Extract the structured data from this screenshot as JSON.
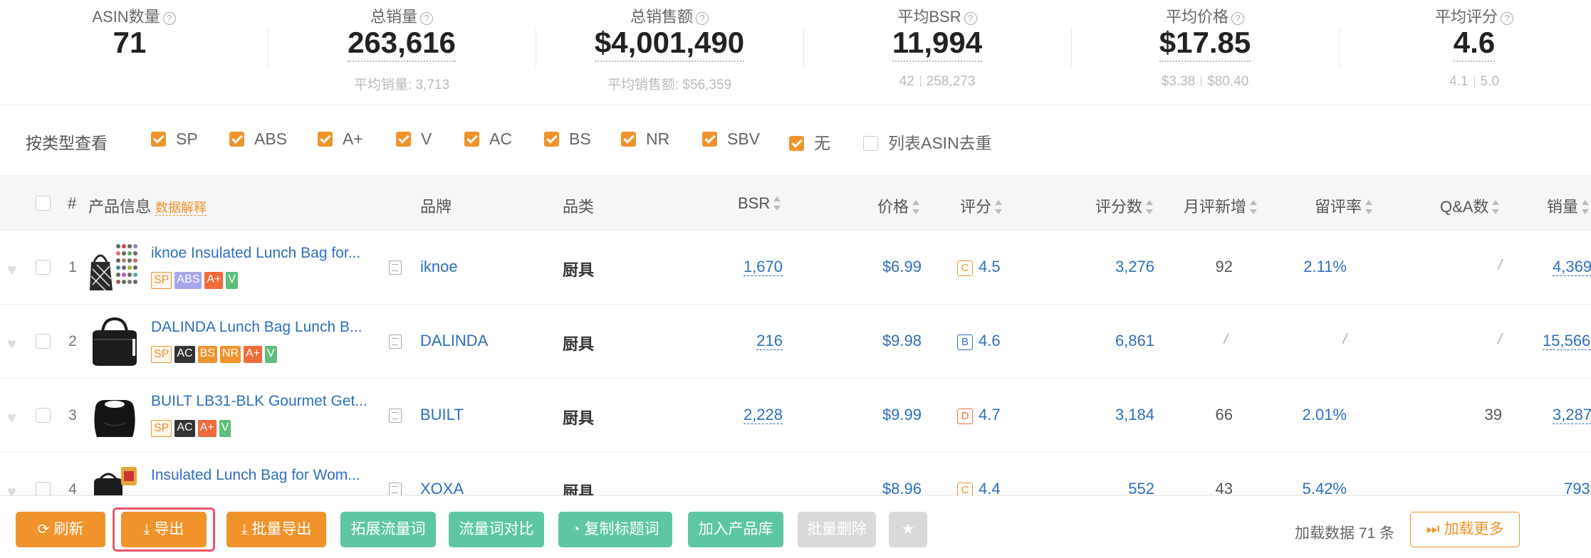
{
  "stats": [
    {
      "label": "ASIN数量",
      "value": "71",
      "sub": ""
    },
    {
      "label": "总销量",
      "value": "263,616",
      "sub": "平均销量: 3,713"
    },
    {
      "label": "总销售额",
      "value": "$4,001,490",
      "sub": "平均销售额: $56,359"
    },
    {
      "label": "平均BSR",
      "value": "11,994",
      "sub_min": "42",
      "sub_max": "258,273"
    },
    {
      "label": "平均价格",
      "value": "$17.85",
      "sub_min": "$3.38",
      "sub_max": "$80.40"
    },
    {
      "label": "平均评分",
      "value": "4.6",
      "sub_min": "4.1",
      "sub_max": "5.0"
    }
  ],
  "filter": {
    "title": "按类型查看",
    "options": [
      {
        "label": "SP",
        "checked": true
      },
      {
        "label": "ABS",
        "checked": true
      },
      {
        "label": "A+",
        "checked": true
      },
      {
        "label": "V",
        "checked": true
      },
      {
        "label": "AC",
        "checked": true
      },
      {
        "label": "BS",
        "checked": true
      },
      {
        "label": "NR",
        "checked": true
      },
      {
        "label": "SBV",
        "checked": true
      },
      {
        "label": "无",
        "checked": true
      },
      {
        "label": "列表ASIN去重",
        "checked": false
      }
    ]
  },
  "table": {
    "headers": {
      "index": "#",
      "product": "产品信息",
      "explain": "数据解释",
      "brand": "品牌",
      "category": "品类",
      "bsr": "BSR",
      "price": "价格",
      "rating": "评分",
      "rating_count": "评分数",
      "monthly_new_reviews": "月评新增",
      "review_rate": "留评率",
      "qa": "Q&A数",
      "sales": "销量"
    },
    "rows": [
      {
        "index": "1",
        "name": "iknoe Insulated Lunch Bag for...",
        "tags": [
          "SP",
          "ABS",
          "A+",
          "V"
        ],
        "brand": "iknoe",
        "category": "厨具",
        "bsr": "1,670",
        "price": "$6.99",
        "grade": "C",
        "rating": "4.5",
        "rating_count": "3,276",
        "monthly_new": "92",
        "review_rate": "2.11%",
        "qa": "/",
        "sales": "4,369"
      },
      {
        "index": "2",
        "name": "DALINDA Lunch Bag Lunch B...",
        "tags": [
          "SP",
          "AC",
          "BS",
          "NR",
          "A+",
          "V"
        ],
        "brand": "DALINDA",
        "category": "厨具",
        "bsr": "216",
        "price": "$9.98",
        "grade": "B",
        "rating": "4.6",
        "rating_count": "6,861",
        "monthly_new": "/",
        "review_rate": "/",
        "qa": "/",
        "sales": "15,566"
      },
      {
        "index": "3",
        "name": "BUILT LB31-BLK Gourmet Get...",
        "tags": [
          "SP",
          "AC",
          "A+",
          "V"
        ],
        "brand": "BUILT",
        "category": "厨具",
        "bsr": "2,228",
        "price": "$9.99",
        "grade": "D",
        "rating": "4.7",
        "rating_count": "3,184",
        "monthly_new": "66",
        "review_rate": "2.01%",
        "qa": "39",
        "sales": "3,287"
      },
      {
        "index": "4",
        "name": "Insulated Lunch Bag for Wom...",
        "tags": [],
        "brand": "XOXA",
        "category": "厨具",
        "bsr": "",
        "price": "$8.96",
        "grade": "C",
        "rating": "4.4",
        "rating_count": "552",
        "monthly_new": "43",
        "review_rate": "5.42%",
        "qa": "",
        "sales": "793"
      }
    ]
  },
  "toolbar": {
    "refresh": "刷新",
    "export": "导出",
    "batch_export": "批量导出",
    "expand_traffic": "拓展流量词",
    "traffic_compare": "流量词对比",
    "copy_title": "复制标题词",
    "add_to_library": "加入产品库",
    "batch_delete": "批量删除",
    "load_info": "加载数据 71 条",
    "load_more": "加载更多"
  },
  "colors": {
    "accent": "#f0932b",
    "link": "#2e6fbd",
    "teal": "#5ec6a4",
    "highlight": "#e8566b"
  }
}
